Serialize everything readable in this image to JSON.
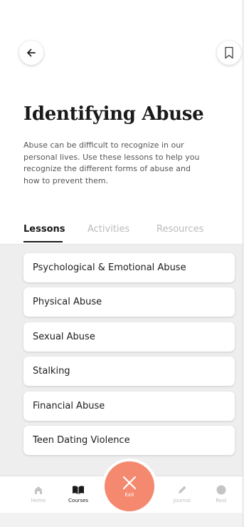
{
  "header": {
    "back_icon": "arrow-left-icon",
    "bookmark_icon": "bookmark-icon"
  },
  "page": {
    "title": "Identifying Abuse",
    "description": "Abuse can be difficult to recognize in our personal lives. Use these lessons to help you recognize the different forms of abuse and how to prevent them."
  },
  "tabs": [
    {
      "label": "Lessons",
      "active": true
    },
    {
      "label": "Activities",
      "active": false
    },
    {
      "label": "Resources",
      "active": false
    }
  ],
  "lessons": [
    "Psychological & Emotional Abuse",
    "Physical Abuse",
    "Sexual Abuse",
    "Stalking",
    "Financial Abuse",
    "Teen Dating Violence"
  ],
  "nav": {
    "home": {
      "label": "Home",
      "icon": "home-icon"
    },
    "courses": {
      "label": "Courses",
      "icon": "book-icon"
    },
    "exit": {
      "label": "Exit",
      "icon": "close-icon"
    },
    "journal": {
      "label": "Journal",
      "icon": "pencil-icon"
    },
    "rest": {
      "label": "Rest",
      "icon": "circle-icon"
    }
  },
  "colors": {
    "accent": "#f4896f",
    "text": "#1a1a1a",
    "muted": "#bbbbbb"
  }
}
